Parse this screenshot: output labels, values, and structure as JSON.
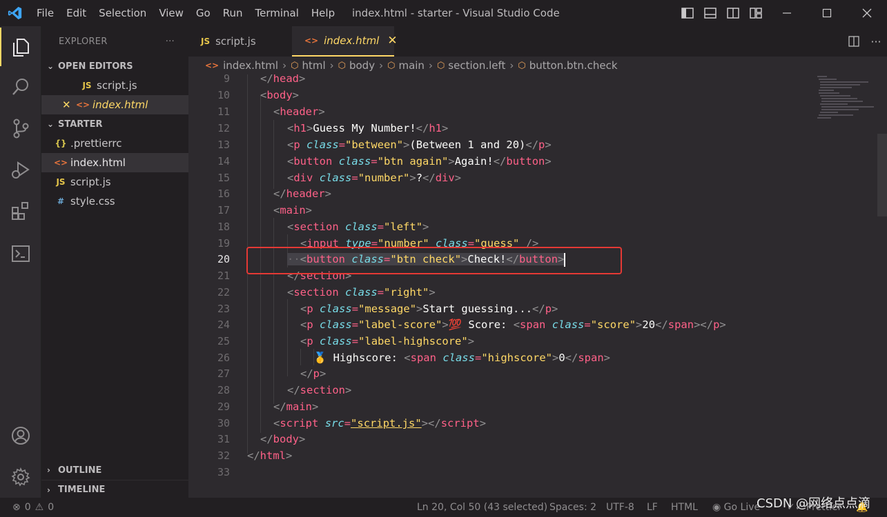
{
  "menu": [
    "File",
    "Edit",
    "Selection",
    "View",
    "Go",
    "Run",
    "Terminal",
    "Help"
  ],
  "window_title": "index.html - starter - Visual Studio Code",
  "colors": {
    "accent": "#ffd866",
    "tag": "#ff6188",
    "attr": "#78dce8",
    "string": "#ffd866",
    "selection_box": "#e53935"
  },
  "sidebar": {
    "explorer_title": "EXPLORER",
    "more": "···",
    "open_editors_label": "OPEN EDITORS",
    "open_editors": [
      {
        "icon": "JS",
        "name": "script.js"
      },
      {
        "icon": "<>",
        "name": "index.html",
        "close": "✕"
      }
    ],
    "project_label": "STARTER",
    "files": [
      {
        "icon": "{}",
        "name": ".prettierrc"
      },
      {
        "icon": "<>",
        "name": "index.html"
      },
      {
        "icon": "JS",
        "name": "script.js"
      },
      {
        "icon": "#",
        "name": "style.css"
      }
    ],
    "outline_label": "OUTLINE",
    "timeline_label": "TIMELINE"
  },
  "tabs": [
    {
      "icon": "JS",
      "label": "script.js"
    },
    {
      "icon": "<>",
      "label": "index.html",
      "close": "✕"
    }
  ],
  "breadcrumb": [
    "index.html",
    "html",
    "body",
    "main",
    "section.left",
    "button.btn.check"
  ],
  "editor": {
    "line_numbers": [
      "9",
      "10",
      "11",
      "12",
      "13",
      "14",
      "15",
      "16",
      "17",
      "18",
      "19",
      "20",
      "21",
      "22",
      "23",
      "24",
      "25",
      "26",
      "27",
      "28",
      "29",
      "30",
      "31",
      "32",
      "33"
    ],
    "current_line": "20",
    "lines": {
      "l9": "</head>",
      "l12_text": "Guess My Number!",
      "l13_val": "\"between\"",
      "l13_text": "(Between 1 and 20)",
      "l14_val": "\"btn again\"",
      "l14_text": "Again!",
      "l15_val": "\"number\"",
      "l15_text": "?",
      "l18_val": "\"left\"",
      "l19_type": "\"number\"",
      "l19_val": "\"guess\"",
      "l20_val": "\"btn check\"",
      "l20_text": "Check!",
      "l22_val": "\"right\"",
      "l23_val": "\"message\"",
      "l23_text": "Start guessing...",
      "l24_val": "\"label-score\"",
      "l24_emoji": "💯",
      "l24_text": " Score: ",
      "l24_span_val": "\"score\"",
      "l24_score": "20",
      "l25_val": "\"label-highscore\"",
      "l26_emoji": "🥇",
      "l26_text": " Highscore: ",
      "l26_span_val": "\"highscore\"",
      "l26_score": "0",
      "l30_src": "\"script.js\""
    }
  },
  "status": {
    "errors": "0",
    "warnings": "0",
    "position": "Ln 20, Col 50 (43 selected)",
    "spaces": "Spaces: 2",
    "encoding": "UTF-8",
    "eol": "LF",
    "language": "HTML",
    "golive": "Go Live",
    "prettier": "Prettier"
  },
  "watermark": "CSDN @网络点点滴"
}
